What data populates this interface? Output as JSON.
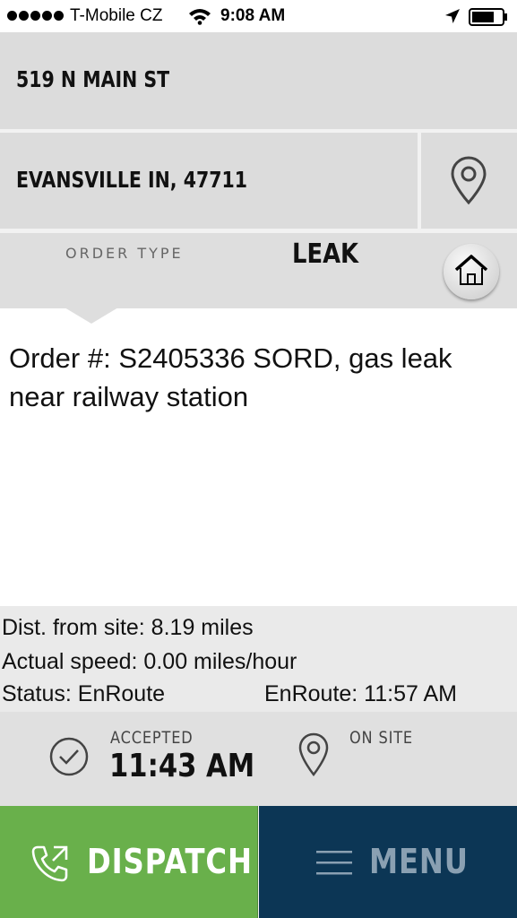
{
  "status_bar": {
    "carrier": "T-Mobile CZ",
    "time": "9:08 AM",
    "icons": [
      "signal-dots",
      "wifi-icon",
      "location-arrow-icon",
      "battery-icon"
    ]
  },
  "address": {
    "street": "519 N MAIN ST",
    "city_state_zip": "EVANSVILLE IN, 47711",
    "map_pin_icon": "map-pin-icon"
  },
  "order_type": {
    "label": "ORDER TYPE",
    "value": "LEAK",
    "home_icon": "home-icon"
  },
  "order": {
    "description": "Order #: S2405336 SORD, gas leak near railway station"
  },
  "info": {
    "distance": "Dist. from site: 8.19 miles",
    "speed": "Actual speed: 0.00 miles/hour",
    "status": "Status: EnRoute",
    "enroute_time": "EnRoute: 11:57 AM"
  },
  "progress": {
    "accepted_label": "ACCEPTED",
    "accepted_time": "11:43 AM",
    "onsite_label": "ON SITE"
  },
  "actions": {
    "dispatch_label": "DISPATCH",
    "menu_label": "MENU"
  },
  "colors": {
    "dispatch_bg": "#69b04b",
    "menu_bg": "#0c3655",
    "panel_gray": "#dcdcdc"
  }
}
